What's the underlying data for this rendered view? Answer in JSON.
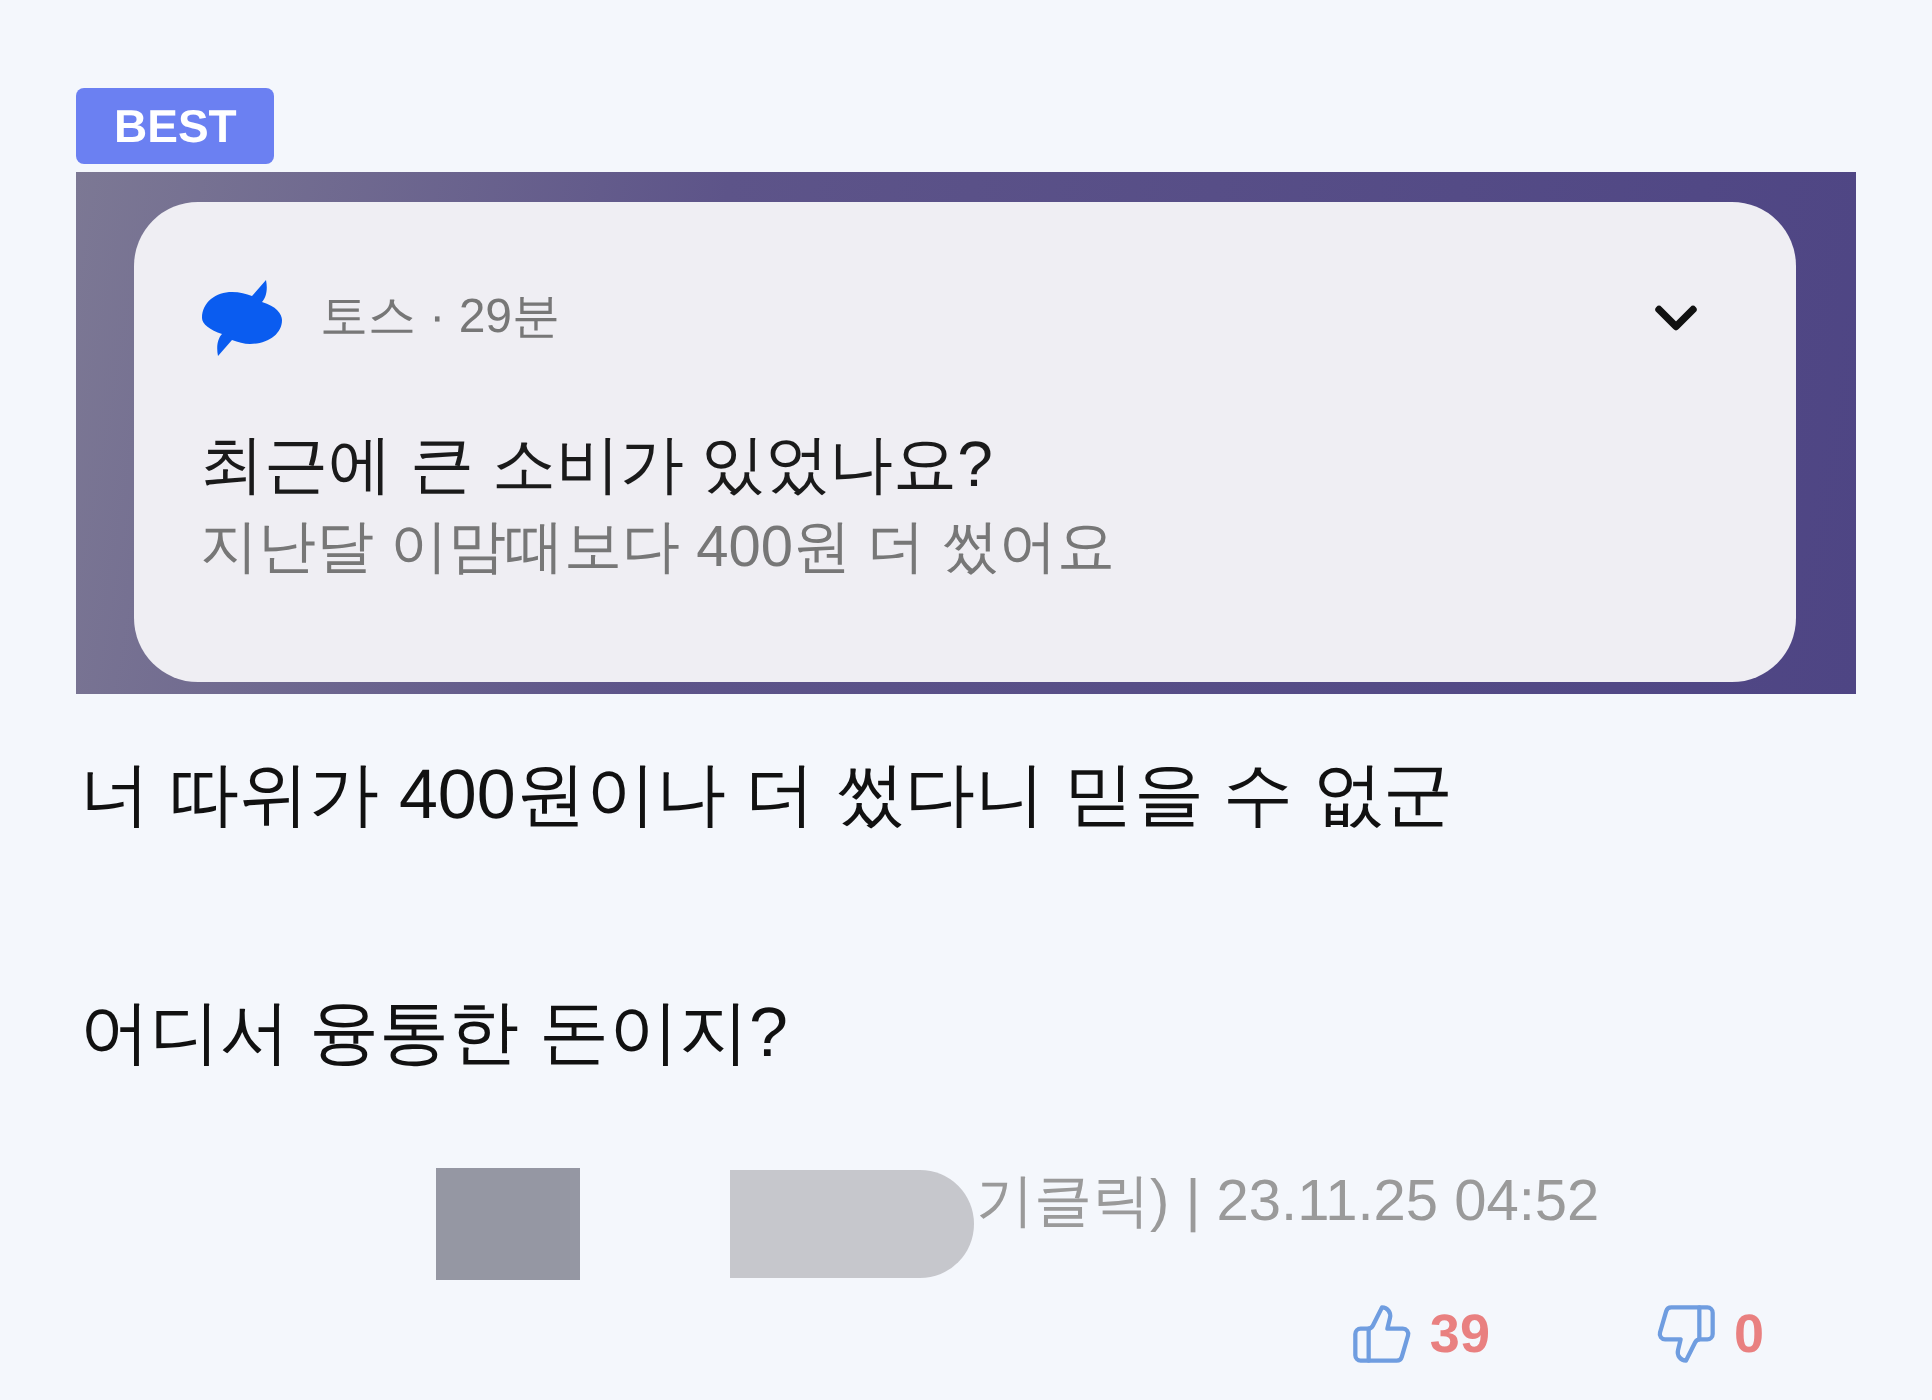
{
  "badge": "BEST",
  "notification": {
    "source": "토스 · 29분",
    "title": "최근에 큰 소비가 있었나요?",
    "body": "지난달 이맘때보다 400원 더 썼어요"
  },
  "comment": {
    "lines": [
      "너 따위가 400원이나 더 썼다니 믿을 수 없군",
      "어디서 융통한 돈이지?"
    ]
  },
  "meta": {
    "text": "기클릭) | 23.11.25 04:52"
  },
  "votes": {
    "likes": "39",
    "dislikes": "0"
  }
}
